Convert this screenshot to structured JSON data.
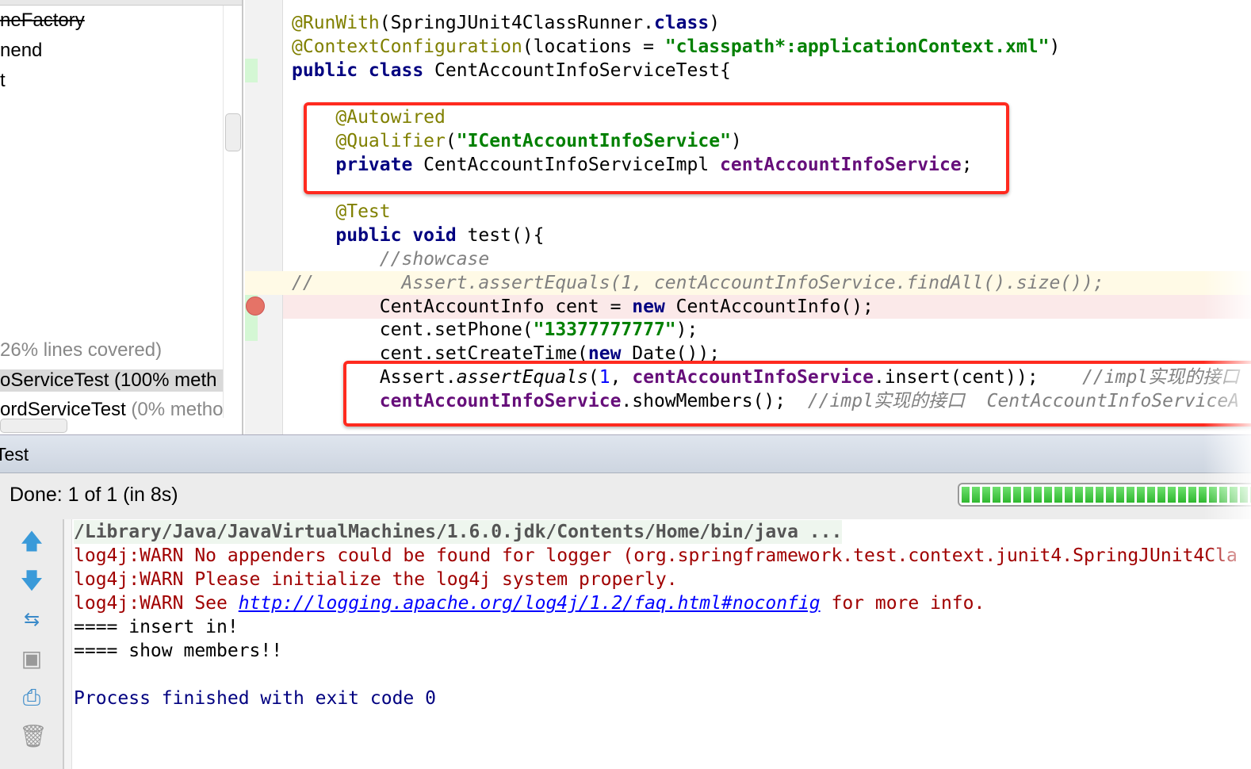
{
  "project_tree": {
    "items": [
      {
        "text": "neFactory",
        "style": "strike"
      },
      {
        "text": "nend",
        "style": "normal"
      },
      {
        "text": "t",
        "style": "normal"
      },
      {
        "text": " 26% lines covered)",
        "style": "gray"
      },
      {
        "text": "oServiceTest (100% meth",
        "style": "selected"
      },
      {
        "text": "ordServiceTest",
        "suffix": " (0% metho",
        "style": "normal"
      }
    ]
  },
  "code_lines": [
    [
      [
        "@RunWith",
        "ann"
      ],
      [
        "(SpringJUnit4ClassRunner.",
        ""
      ],
      [
        "class",
        "kw"
      ],
      [
        ")",
        ""
      ]
    ],
    [
      [
        "@ContextConfiguration",
        "ann"
      ],
      [
        "(locations = ",
        ""
      ],
      [
        "\"classpath*:applicationContext.xml\"",
        "str"
      ],
      [
        ")",
        ""
      ]
    ],
    [
      [
        "public class ",
        "kw"
      ],
      [
        "CentAccountInfoServiceTest{",
        ""
      ]
    ],
    [],
    [
      [
        "    ",
        ""
      ],
      [
        "@Autowired",
        "ann"
      ]
    ],
    [
      [
        "    ",
        ""
      ],
      [
        "@Qualifier",
        "ann"
      ],
      [
        "(",
        ""
      ],
      [
        "\"ICentAccountInfoService\"",
        "str"
      ],
      [
        ")",
        ""
      ]
    ],
    [
      [
        "    ",
        ""
      ],
      [
        "private ",
        "kw"
      ],
      [
        "CentAccountInfoServiceImpl ",
        ""
      ],
      [
        "centAccountInfoService",
        "fld"
      ],
      [
        ";",
        ""
      ]
    ],
    [],
    [
      [
        "    ",
        ""
      ],
      [
        "@Test",
        "ann"
      ]
    ],
    [
      [
        "    ",
        ""
      ],
      [
        "public void ",
        "kw"
      ],
      [
        "test(){",
        ""
      ]
    ],
    [
      [
        "        ",
        ""
      ],
      [
        "//showcase",
        "cmt"
      ]
    ],
    [
      [
        "//        Assert.assertEquals(1, centAccountInfoService.findAll().size());",
        "cmt"
      ]
    ],
    [
      [
        "        CentAccountInfo cent = ",
        ""
      ],
      [
        "new ",
        "kw"
      ],
      [
        "CentAccountInfo();",
        ""
      ]
    ],
    [
      [
        "        cent.setPhone(",
        ""
      ],
      [
        "\"13377777777\"",
        "str"
      ],
      [
        ");",
        ""
      ]
    ],
    [
      [
        "        cent.setCreateTime(",
        ""
      ],
      [
        "new ",
        "kw"
      ],
      [
        "Date());",
        ""
      ]
    ],
    [
      [
        "        Assert.",
        ""
      ],
      [
        "assertEquals",
        "it"
      ],
      [
        "(",
        ""
      ],
      [
        "1",
        "num"
      ],
      [
        ", ",
        ""
      ],
      [
        "centAccountInfoService",
        "fld"
      ],
      [
        ".insert(cent));    ",
        ""
      ],
      [
        "//impl实现的接口",
        "cmt"
      ]
    ],
    [
      [
        "        ",
        ""
      ],
      [
        "centAccountInfoService",
        "fld"
      ],
      [
        ".showMembers();  ",
        ""
      ],
      [
        "//impl实现的接口  CentAccountInfoServiceA",
        "cmt"
      ]
    ]
  ],
  "run_panel": {
    "tab_label": "Test",
    "status": "Done: 1 of 1 (in 8s)",
    "progress_percent": 100,
    "status_color": "#2fb82f"
  },
  "toolbar_icons": [
    "arrow-up-icon",
    "arrow-down-icon",
    "toggle-swap-icon",
    "export-icon",
    "print-icon",
    "trash-icon"
  ],
  "console": {
    "lines": [
      {
        "text": "/Library/Java/JavaVirtualMachines/1.6.0.jdk/Contents/Home/bin/java ...",
        "cls": "cmd"
      },
      {
        "text": "log4j:WARN No appenders could be found for logger (org.springframework.test.context.junit4.SpringJUnit4Cla",
        "cls": "err"
      },
      {
        "text": "log4j:WARN Please initialize the log4j system properly.",
        "cls": "err"
      },
      {
        "text": "log4j:WARN See ",
        "cls": "err",
        "link": "http://logging.apache.org/log4j/1.2/faq.html#noconfig",
        "after": " for more info."
      },
      {
        "text": "==== insert in!",
        "cls": "out"
      },
      {
        "text": "==== show members!!",
        "cls": "out"
      },
      {
        "text": "",
        "cls": "out"
      },
      {
        "text": "Process finished with exit code 0",
        "cls": "sys"
      }
    ]
  },
  "colors": {
    "highlight_box": "#ff2a1f",
    "error_text": "#a00000",
    "link": "#0000ff",
    "system_text": "#000080"
  }
}
